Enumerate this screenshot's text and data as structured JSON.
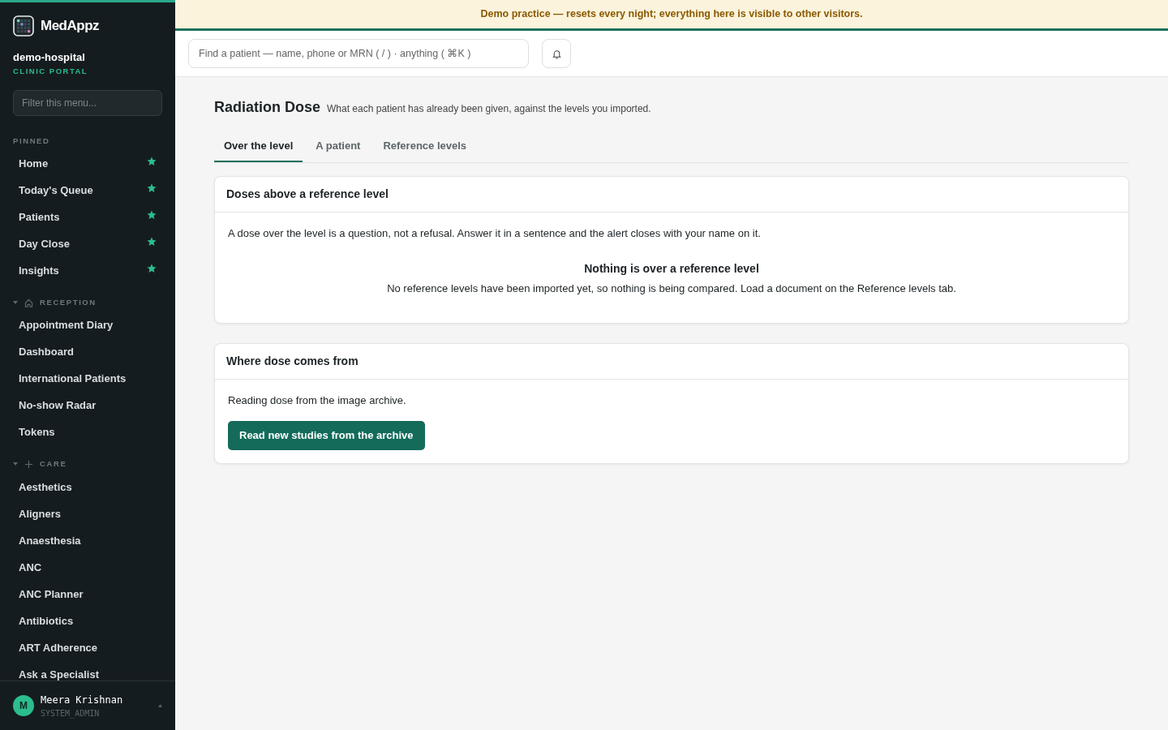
{
  "brand": {
    "name": "MedAppz",
    "org": "demo-hospital",
    "portal": "CLINIC PORTAL"
  },
  "sidebar": {
    "filter_placeholder": "Filter this menu...",
    "groups": [
      {
        "label": "PINNED",
        "kind": "plain",
        "items": [
          {
            "label": "Home",
            "pinned": true
          },
          {
            "label": "Today's Queue",
            "pinned": true
          },
          {
            "label": "Patients",
            "pinned": true
          },
          {
            "label": "Day Close",
            "pinned": true
          },
          {
            "label": "Insights",
            "pinned": true
          }
        ]
      },
      {
        "label": "RECEPTION",
        "kind": "house",
        "expanded": true,
        "items": [
          {
            "label": "Appointment Diary",
            "pinned": false
          },
          {
            "label": "Dashboard",
            "pinned": false
          },
          {
            "label": "International Patients",
            "pinned": false
          },
          {
            "label": "No-show Radar",
            "pinned": false
          },
          {
            "label": "Tokens",
            "pinned": false
          }
        ]
      },
      {
        "label": "CARE",
        "kind": "plus",
        "expanded": true,
        "items": [
          {
            "label": "Aesthetics",
            "pinned": false
          },
          {
            "label": "Aligners",
            "pinned": false
          },
          {
            "label": "Anaesthesia",
            "pinned": false
          },
          {
            "label": "ANC",
            "pinned": false
          },
          {
            "label": "ANC Planner",
            "pinned": false
          },
          {
            "label": "Antibiotics",
            "pinned": false
          },
          {
            "label": "ART Adherence",
            "pinned": false
          },
          {
            "label": "Ask a Specialist",
            "pinned": false
          }
        ]
      }
    ],
    "user": {
      "initial": "M",
      "name": "Meera Krishnan",
      "role": "SYSTEM_ADMIN"
    }
  },
  "banner": "Demo practice — resets every night; everything here is visible to other visitors.",
  "search": {
    "placeholder": "Find a patient — name, phone or MRN ( / ) · anything ( ⌘K )"
  },
  "page": {
    "title": "Radiation Dose",
    "subtitle": "What each patient has already been given, against the levels you imported.",
    "tabs": [
      {
        "label": "Over the level",
        "selected": true
      },
      {
        "label": "A patient",
        "selected": false
      },
      {
        "label": "Reference levels",
        "selected": false
      }
    ],
    "cards": [
      {
        "title": "Doses above a reference level",
        "text": "A dose over the level is a question, not a refusal. Answer it in a sentence and the alert closes with your name on it.",
        "empty_title": "Nothing is over a reference level",
        "empty_text": "No reference levels have been imported yet, so nothing is being compared. Load a document on the Reference levels tab."
      },
      {
        "title": "Where dose comes from",
        "text": "Reading dose from the image archive.",
        "button": "Read new studies from the archive"
      }
    ]
  }
}
